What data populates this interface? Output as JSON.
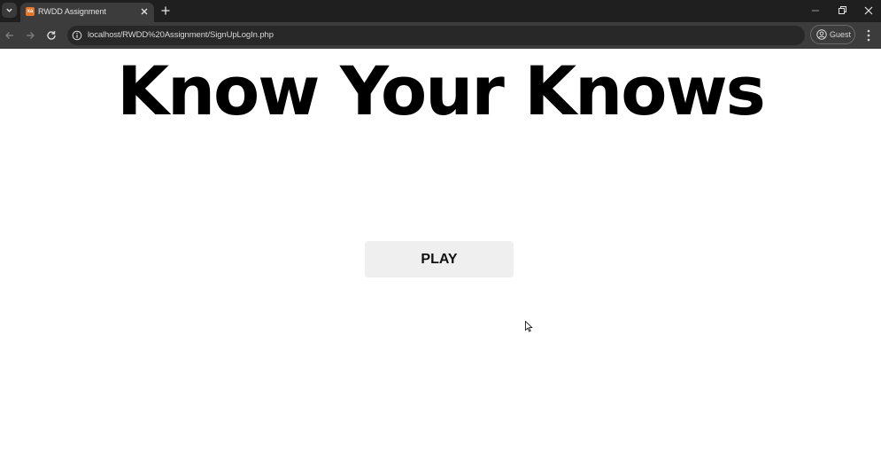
{
  "browser": {
    "tab_title": "RWDD Assignment",
    "favicon_text": "xa",
    "url": "localhost/RWDD%20Assignment/SignUpLogIn.php",
    "profile_label": "Guest",
    "icons": {
      "tab_search": "chevron-down-icon",
      "tab_close": "close-icon",
      "new_tab": "plus-icon",
      "back": "back-arrow-icon",
      "forward": "forward-arrow-icon",
      "reload": "reload-icon",
      "site_info": "info-icon",
      "profile": "person-icon",
      "menu": "kebab-menu-icon",
      "minimize": "minimize-icon",
      "restore": "restore-icon",
      "window_close": "close-icon"
    },
    "colors": {
      "tabstrip": "#1f1f1f",
      "toolbar": "#3c3c3c",
      "favicon": "#e8752a"
    }
  },
  "page": {
    "title": "Know Your Knows",
    "play_label": "PLAY",
    "colors": {
      "background": "#ffffff",
      "title": "#000000",
      "button_bg": "#efefef"
    }
  }
}
